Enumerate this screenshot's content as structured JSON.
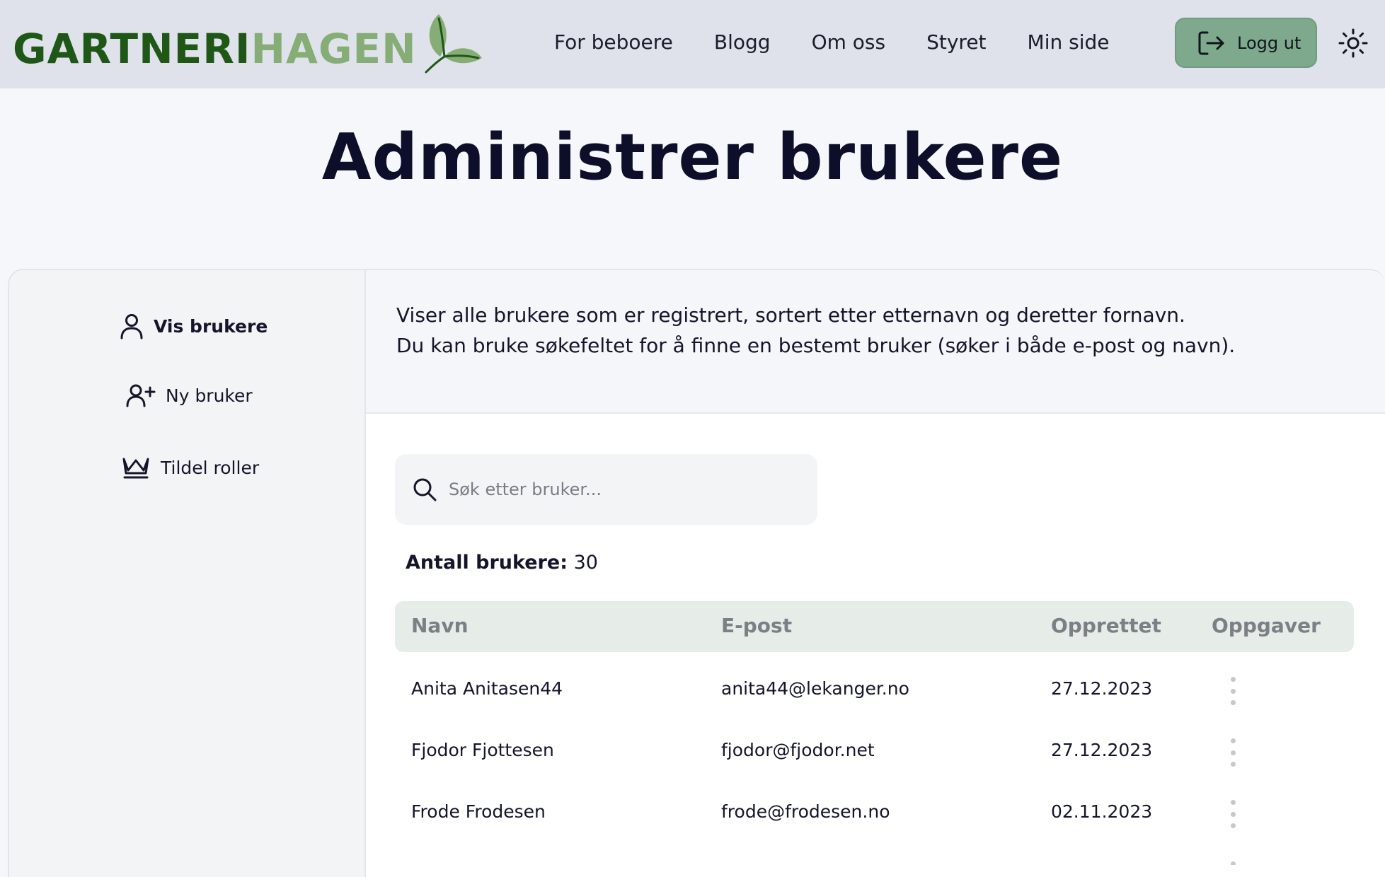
{
  "header": {
    "logo_dark": "GARTNERI",
    "logo_light": "HAGEN",
    "nav": [
      "For beboere",
      "Blogg",
      "Om oss",
      "Styret",
      "Min side"
    ],
    "logout_label": "Logg ut",
    "icons": {
      "logout": "logout-icon",
      "theme": "sun-icon",
      "logo": "leaf-icon"
    }
  },
  "page": {
    "title": "Administrer brukere"
  },
  "sidebar": {
    "items": [
      {
        "label": "Vis brukere",
        "icon": "user-icon",
        "active": true
      },
      {
        "label": "Ny bruker",
        "icon": "user-plus-icon",
        "active": false
      },
      {
        "label": "Tildel roller",
        "icon": "crown-icon",
        "active": false
      }
    ]
  },
  "info": {
    "line1": "Viser alle brukere som er registrert, sortert etter etternavn og deretter fornavn.",
    "line2": "Du kan bruke søkefeltet for å finne en bestemt bruker (søker i både e-post og navn)."
  },
  "search": {
    "placeholder": "Søk etter bruker...",
    "value": ""
  },
  "count": {
    "label": "Antall brukere:",
    "value": "30"
  },
  "table": {
    "headers": [
      "Navn",
      "E-post",
      "Opprettet",
      "Oppgaver"
    ],
    "rows": [
      {
        "name": "Anita Anitasen44",
        "email": "anita44@lekanger.no",
        "created": "27.12.2023"
      },
      {
        "name": "Fjodor Fjottesen",
        "email": "fjodor@fjodor.net",
        "created": "27.12.2023"
      },
      {
        "name": "Frode Frodesen",
        "email": "frode@frodesen.no",
        "created": "02.11.2023"
      }
    ]
  },
  "colors": {
    "header_bg": "#dfe2ea",
    "logo_dark": "#1f5716",
    "logo_light": "#86ad76",
    "logout_bg": "#7fa98c",
    "table_head_bg": "#e6ece7"
  }
}
